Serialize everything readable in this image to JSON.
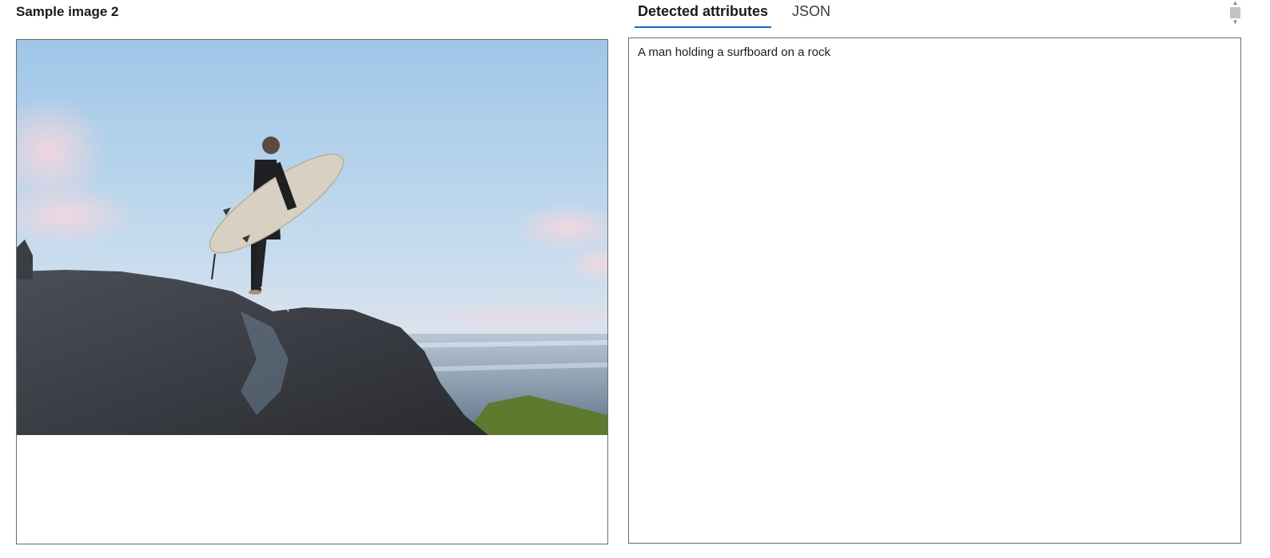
{
  "sample": {
    "title": "Sample image 2",
    "image_alt": "A man holding a surfboard on a rock"
  },
  "tabs": [
    {
      "label": "Detected attributes",
      "active": true
    },
    {
      "label": "JSON",
      "active": false
    }
  ],
  "results": {
    "caption": "A man holding a surfboard on a rock"
  },
  "scrollbar": {
    "up_icon": "chevron-up-icon",
    "down_icon": "chevron-down-icon"
  },
  "colors": {
    "accent": "#0f6cbd",
    "border": "#6b6b6b"
  }
}
